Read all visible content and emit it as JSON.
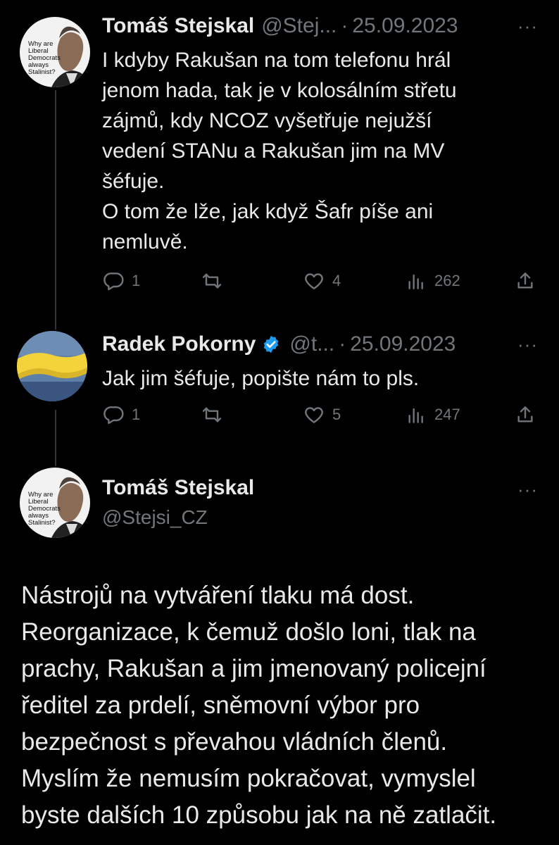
{
  "colors": {
    "background": "#000000",
    "text": "#e7e9ea",
    "muted": "#71767b",
    "verified": "#1d9bf0"
  },
  "avatar_caption_tomas": "Why are Liberal Democrats always Stalinist?",
  "tweets": [
    {
      "name": "Tomáš Stejskal",
      "handle": "@Stej...",
      "separator": "·",
      "date": "25.09.2023",
      "lines": [
        "I kdyby Rakušan na tom telefonu hrál",
        "jenom hada, tak je v kolosálním střetu",
        "zájmů, kdy NCOZ vyšetřuje nejužší",
        "vedení STANu a Rakušan jim na MV",
        "šéfuje.",
        "O tom že lže, jak když Šafr píše ani",
        "nemluvě."
      ],
      "replies": "1",
      "retweets": "",
      "likes": "4",
      "views": "262",
      "icons": [
        "reply-icon",
        "retweet-icon",
        "like-icon",
        "views-icon",
        "share-icon"
      ]
    },
    {
      "name": "Radek Pokorny",
      "verified": true,
      "handle": "@t...",
      "separator": "·",
      "date": "25.09.2023",
      "lines": [
        "Jak jim šéfuje, popište nám to pls."
      ],
      "replies": "1",
      "retweets": "",
      "likes": "5",
      "views": "247",
      "icons": [
        "reply-icon",
        "retweet-icon",
        "like-icon",
        "views-icon",
        "share-icon"
      ]
    }
  ],
  "main": {
    "name": "Tomáš Stejskal",
    "handle": "@Stejsi_CZ",
    "lines": [
      "Nástrojů na vytváření tlaku má dost.",
      "Reorganizace, k čemuž došlo loni, tlak na",
      "prachy, Rakušan a jim jmenovaný policejní",
      "ředitel za prdelí, sněmovní výbor pro",
      "bezpečnost s převahou vládních členů.",
      "Myslím že nemusím pokračovat, vymyslel",
      "byste dalších 10 způsobu jak na ně zatlačit."
    ]
  },
  "more_label": "···"
}
